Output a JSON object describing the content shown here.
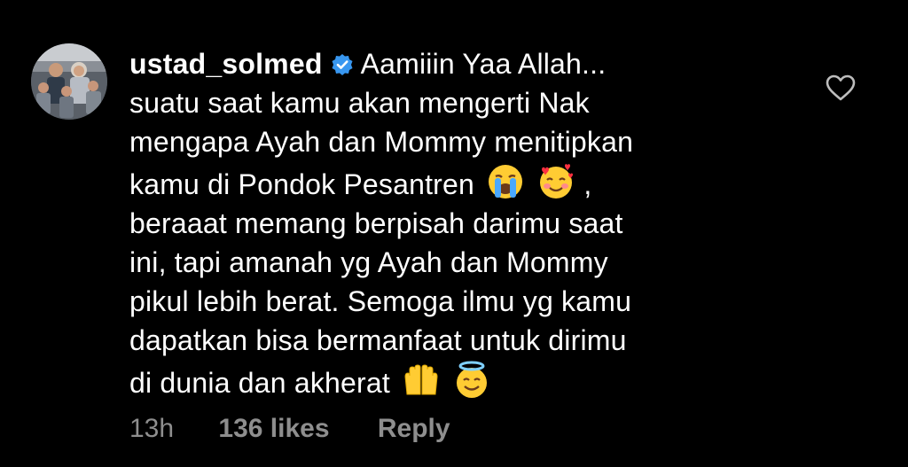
{
  "comment": {
    "username": "ustad_solmed",
    "verified_icon": "verified-badge-icon",
    "lines": [
      "Aamiiin Yaa Allah...",
      "suatu saat kamu akan mengerti Nak",
      "mengapa Ayah dan Mommy menitipkan",
      "kamu di Pondok Pesantren",
      ",",
      "beraaat memang berpisah darimu saat",
      "ini, tapi amanah yg Ayah dan Mommy",
      "pikul lebih berat. Semoga ilmu yg kamu",
      "dapatkan bisa bermanfaat untuk dirimu",
      "di dunia dan akherat"
    ],
    "emojis": {
      "line4": [
        "loudly-crying-face-emoji",
        "smiling-face-with-hearts-emoji"
      ],
      "line10": [
        "raising-hands-emoji",
        "smiling-face-with-halo-emoji"
      ]
    }
  },
  "meta": {
    "time": "13h",
    "likes": "136 likes",
    "reply": "Reply"
  },
  "like_icon": "heart-outline-icon",
  "colors": {
    "background": "#000000",
    "text": "#ffffff",
    "meta_text": "#8e8e8e",
    "verified_blue": "#3897f0"
  }
}
